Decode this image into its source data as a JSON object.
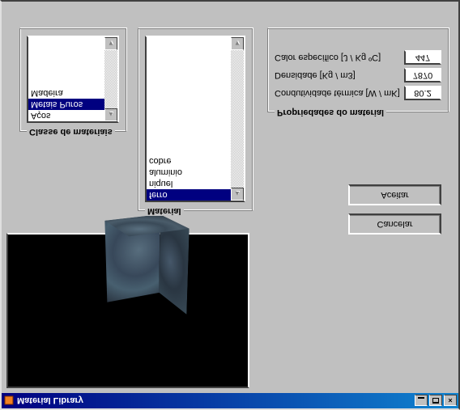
{
  "window": {
    "title": "Material Library"
  },
  "category": {
    "legend": "Classe de materiais",
    "items": [
      "Aços",
      "Metais Puros",
      "Madeira"
    ],
    "selected_index": 1
  },
  "material": {
    "legend": "Material",
    "items": [
      "ferro",
      "niquel",
      "aluminio",
      "cobre"
    ],
    "selected_index": 0
  },
  "properties": {
    "legend": "Propriedades do material",
    "thermal_conductivity": {
      "label": "Condutividade térmica [W / mK]",
      "value": "80.2"
    },
    "density": {
      "label": "Densidade [Kg / m3]",
      "value": "7870"
    },
    "specific_heat": {
      "label": "Calor específico [J / Kg ºC]",
      "value": "447"
    }
  },
  "actions": {
    "accept": "Aceitar",
    "cancel": "Cancelar"
  }
}
